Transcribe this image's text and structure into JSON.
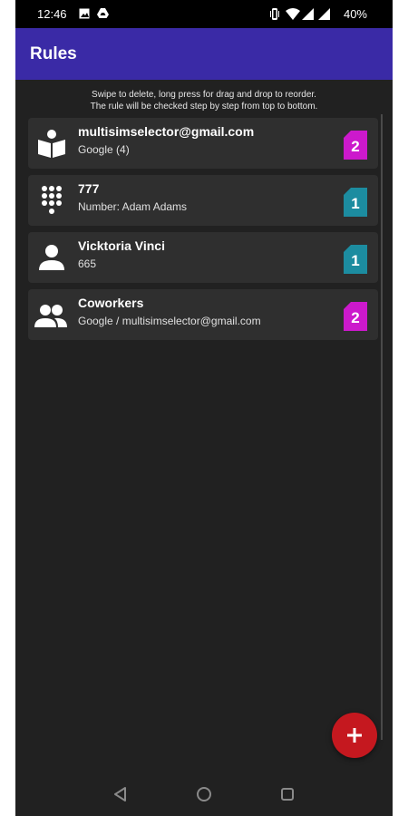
{
  "status_bar": {
    "time": "12:46",
    "battery": "40%",
    "icons": [
      "image-icon",
      "drive-icon",
      "vibrate-icon",
      "wifi-icon",
      "signal-icon",
      "signal-icon"
    ]
  },
  "app_bar": {
    "title": "Rules"
  },
  "hint": {
    "line1": "Swipe to delete, long press for drag and drop to reorder.",
    "line2": "The rule will be checked step by step from top to bottom."
  },
  "rules": [
    {
      "name": "multisimselector@gmail.com",
      "detail": "Google (4)",
      "icon": "contact-book-icon",
      "sim": "2",
      "sim_color": "#cc19cc"
    },
    {
      "name": "777",
      "detail": "Number: Adam Adams",
      "icon": "dialpad-icon",
      "sim": "1",
      "sim_color": "#1c8ca0"
    },
    {
      "name": "Vicktoria Vinci",
      "detail": "665",
      "icon": "person-icon",
      "sim": "1",
      "sim_color": "#1c8ca0"
    },
    {
      "name": "Coworkers",
      "detail": "Google / multisimselector@gmail.com",
      "icon": "group-icon",
      "sim": "2",
      "sim_color": "#cc19cc"
    }
  ],
  "fab": {
    "icon": "plus-icon",
    "color": "#c5181f"
  },
  "navbar": {
    "icons": [
      "back-icon",
      "home-icon",
      "recents-icon"
    ]
  },
  "colors": {
    "app_bar": "#3a2aa6",
    "background": "#212121",
    "card": "#2f2f2f"
  }
}
